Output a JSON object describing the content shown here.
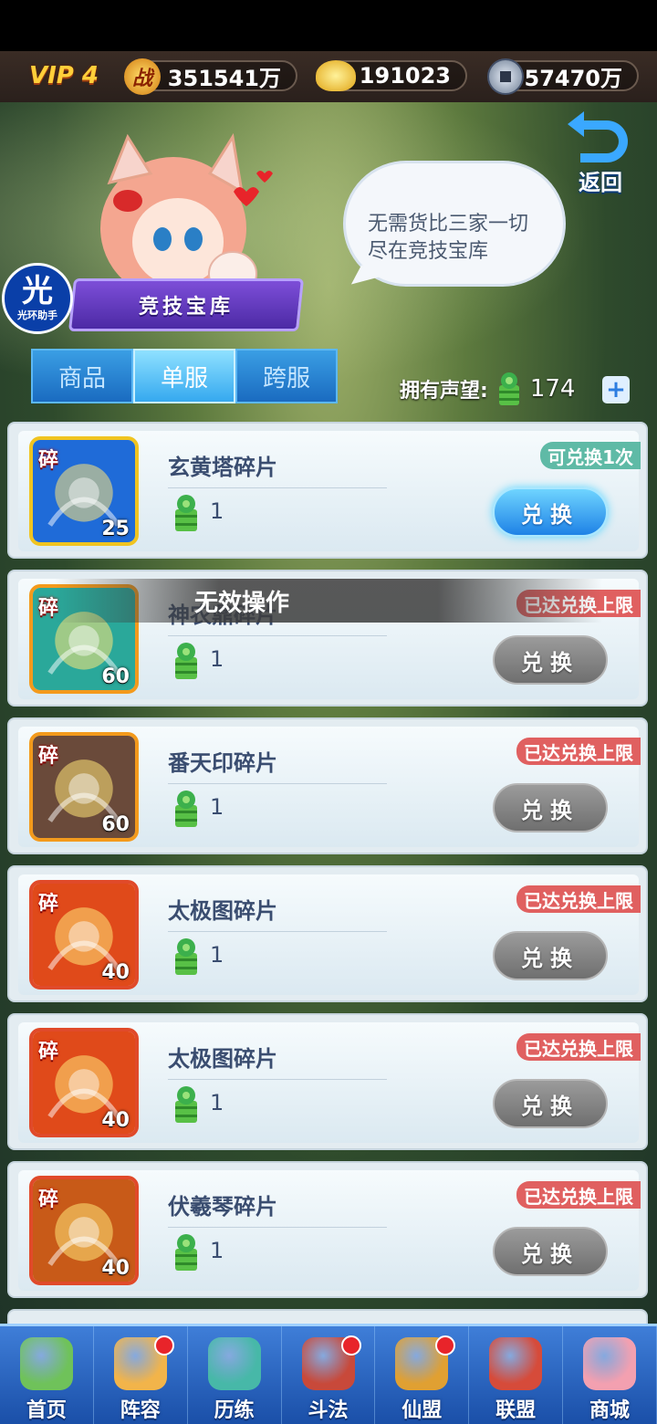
{
  "topbar": {
    "vip": "VIP 4",
    "power_icon": "战",
    "power": "351541万",
    "gold": "191023",
    "coins": "57470万"
  },
  "header": {
    "back_label": "返回",
    "banner_title": "竞技宝库",
    "bubble_text_line1": "无需货比三家一切",
    "bubble_text_line2": "尽在竞技宝库",
    "assistant_char": "光",
    "assistant_label": "光环助手"
  },
  "tabs": [
    {
      "label": "商品",
      "active": false
    },
    {
      "label": "单服",
      "active": true
    },
    {
      "label": "跨服",
      "active": false
    }
  ],
  "reputation": {
    "label": "拥有声望:",
    "value": "174",
    "plus": "+"
  },
  "toast": "无效操作",
  "items": [
    {
      "name": "玄黄塔碎片",
      "tag": "碎",
      "qty": "25",
      "cost": "1",
      "badge": "可兑换1次",
      "badge_type": "ok",
      "button": "兑换",
      "button_enabled": true,
      "frame": "gold",
      "art_color": "#1f6bd8"
    },
    {
      "name": "神农鼎碎片",
      "tag": "碎",
      "qty": "60",
      "cost": "1",
      "badge": "已达兑换上限",
      "badge_type": "limit",
      "button": "兑换",
      "button_enabled": false,
      "frame": "orange",
      "art_color": "#2aa89a"
    },
    {
      "name": "番天印碎片",
      "tag": "碎",
      "qty": "60",
      "cost": "1",
      "badge": "已达兑换上限",
      "badge_type": "limit",
      "button": "兑换",
      "button_enabled": false,
      "frame": "orange",
      "art_color": "#6a4a3a"
    },
    {
      "name": "太极图碎片",
      "tag": "碎",
      "qty": "40",
      "cost": "1",
      "badge": "已达兑换上限",
      "badge_type": "limit",
      "button": "兑换",
      "button_enabled": false,
      "frame": "red",
      "art_color": "#e04a1a"
    },
    {
      "name": "太极图碎片",
      "tag": "碎",
      "qty": "40",
      "cost": "1",
      "badge": "已达兑换上限",
      "badge_type": "limit",
      "button": "兑换",
      "button_enabled": false,
      "frame": "red",
      "art_color": "#e04a1a"
    },
    {
      "name": "伏羲琴碎片",
      "tag": "碎",
      "qty": "40",
      "cost": "1",
      "badge": "已达兑换上限",
      "badge_type": "limit",
      "button": "兑换",
      "button_enabled": false,
      "frame": "red",
      "art_color": "#c85a18"
    }
  ],
  "nav": [
    {
      "label": "首页",
      "icon": "home-island-icon",
      "dot": false,
      "color": "#6fc25a"
    },
    {
      "label": "阵容",
      "icon": "lineup-icon",
      "dot": true,
      "color": "#f2b44a"
    },
    {
      "label": "历练",
      "icon": "training-gourd-icon",
      "dot": false,
      "color": "#47b8a8"
    },
    {
      "label": "斗法",
      "icon": "sword-icon",
      "dot": true,
      "color": "#c8493a"
    },
    {
      "label": "仙盟",
      "icon": "palace-icon",
      "dot": true,
      "color": "#e0a032"
    },
    {
      "label": "联盟",
      "icon": "alliance-banner-icon",
      "dot": false,
      "color": "#d64b3a"
    },
    {
      "label": "商城",
      "icon": "shop-catgirl-icon",
      "dot": false,
      "color": "#f3a0b0"
    }
  ]
}
